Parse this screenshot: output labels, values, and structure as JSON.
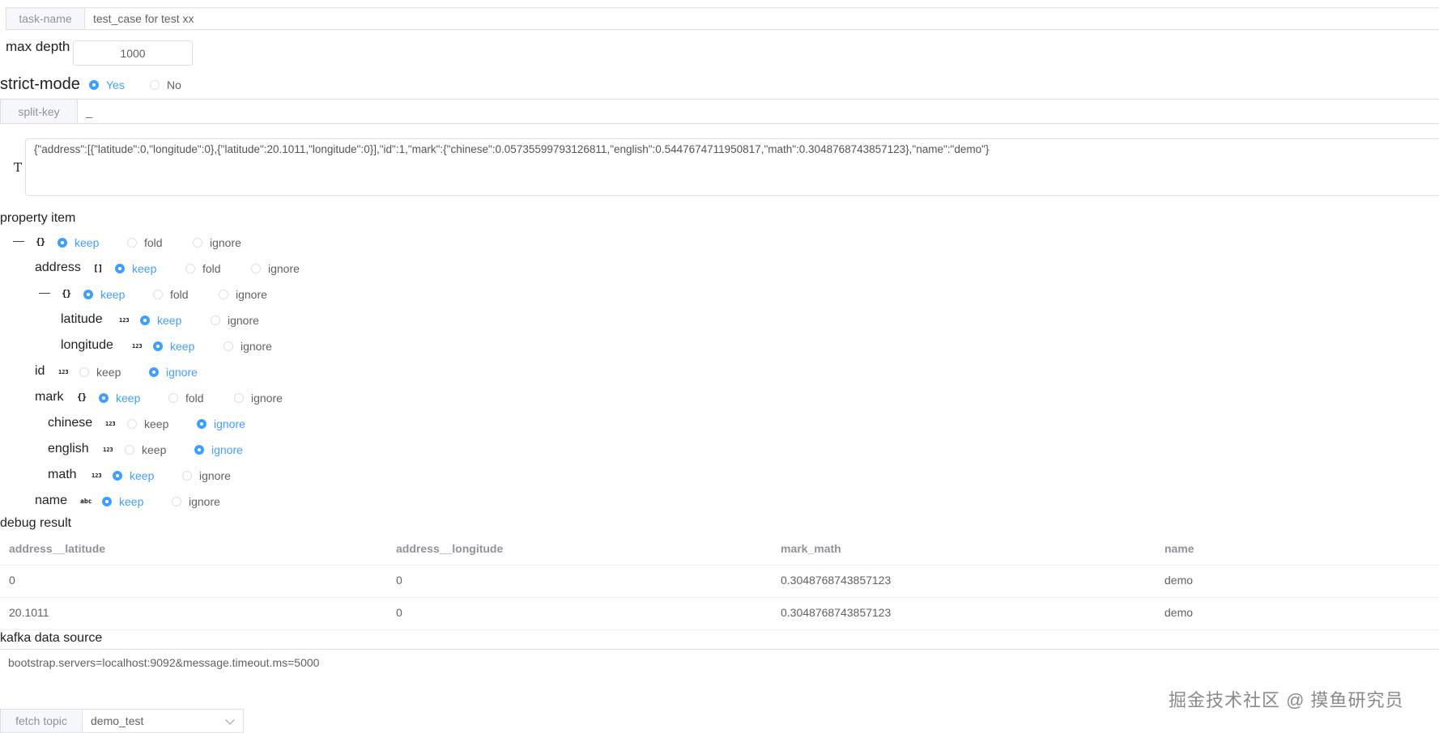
{
  "task": {
    "label": "task-name",
    "value": "test_case for test xx"
  },
  "max_depth": {
    "label": "max depth",
    "value": "1000"
  },
  "strict_mode": {
    "label": "strict-mode",
    "yes": "Yes",
    "no": "No"
  },
  "split_key": {
    "label": "split-key",
    "value": "_"
  },
  "json_input": {
    "type_icon": "T",
    "value": "{\"address\":[{\"latitude\":0,\"longitude\":0},{\"latitude\":20.1011,\"longitude\":0}],\"id\":1,\"mark\":{\"chinese\":0.05735599793126811,\"english\":0.5447674711950817,\"math\":0.3048768743857123},\"name\":\"demo\"}"
  },
  "property_item": {
    "title": "property item",
    "opt_keep": "keep",
    "opt_fold": "fold",
    "opt_ignore": "ignore",
    "collapse_glyph": "—",
    "icons": {
      "object": "{}",
      "array": "[]",
      "number": "123",
      "string": "abc"
    },
    "nodes": {
      "address": "address",
      "latitude": "latitude",
      "longitude": "longitude",
      "id": "id",
      "mark": "mark",
      "chinese": "chinese",
      "english": "english",
      "math": "math",
      "name": "name"
    }
  },
  "debug_result": {
    "title": "debug result",
    "columns": [
      "address__latitude",
      "address__longitude",
      "mark_math",
      "name"
    ],
    "rows": [
      [
        "0",
        "0",
        "0.3048768743857123",
        "demo"
      ],
      [
        "20.1011",
        "0",
        "0.3048768743857123",
        "demo"
      ]
    ]
  },
  "kafka": {
    "title": "kafka data source",
    "value": "bootstrap.servers=localhost:9092&message.timeout.ms=5000"
  },
  "fetch_topic": {
    "label": "fetch topic",
    "value": "demo_test"
  },
  "watermark": "掘金技术社区 @ 摸鱼研究员",
  "colors": {
    "accent": "#409eff",
    "border": "#dcdfe6",
    "addon_bg": "#f5f7fa"
  }
}
